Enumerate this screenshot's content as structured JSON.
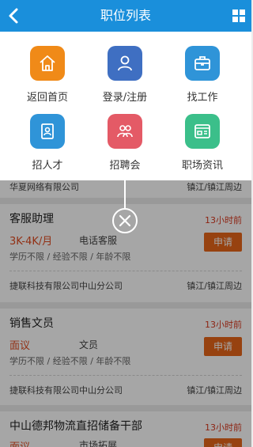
{
  "header": {
    "title": "职位列表",
    "back_icon": "chevron-left-icon",
    "grid_icon": "grid-icon"
  },
  "menu": {
    "items": [
      {
        "label": "返回首页",
        "icon": "home-icon",
        "color": "#f08a18"
      },
      {
        "label": "登录/注册",
        "icon": "user-icon",
        "color": "#3f6fc2"
      },
      {
        "label": "找工作",
        "icon": "briefcase-icon",
        "color": "#2f94d8"
      },
      {
        "label": "招人才",
        "icon": "id-card-icon",
        "color": "#2f94d8"
      },
      {
        "label": "招聘会",
        "icon": "group-icon",
        "color": "#e45a66"
      },
      {
        "label": "职场资讯",
        "icon": "news-icon",
        "color": "#3bbf8a"
      }
    ]
  },
  "jobs": [
    {
      "company": "华夏网络有限公司",
      "location": "镇江/镇江周边"
    },
    {
      "name": "客服助理",
      "time": "13小时前",
      "salary": "3K-4K/月",
      "category": "电话客服",
      "requirements": "学历不限 / 经验不限 / 年龄不限",
      "apply": "申请",
      "company": "捷联科技有限公司中山分公司",
      "location": "镇江/镇江周边"
    },
    {
      "name": "销售文员",
      "time": "13小时前",
      "salary": "面议",
      "category": "文员",
      "requirements": "学历不限 / 经验不限 / 年龄不限",
      "apply": "申请",
      "company": "捷联科技有限公司中山分公司",
      "location": "镇江/镇江周边"
    },
    {
      "name": "中山德邦物流直招储备干部",
      "time": "13小时前",
      "salary": "面议",
      "category": "市场拓展",
      "apply": "申请"
    }
  ],
  "colors": {
    "header": "#1a8fdb",
    "apply": "#e8661a",
    "time": "#d9381e",
    "salary": "#e04a1f"
  }
}
